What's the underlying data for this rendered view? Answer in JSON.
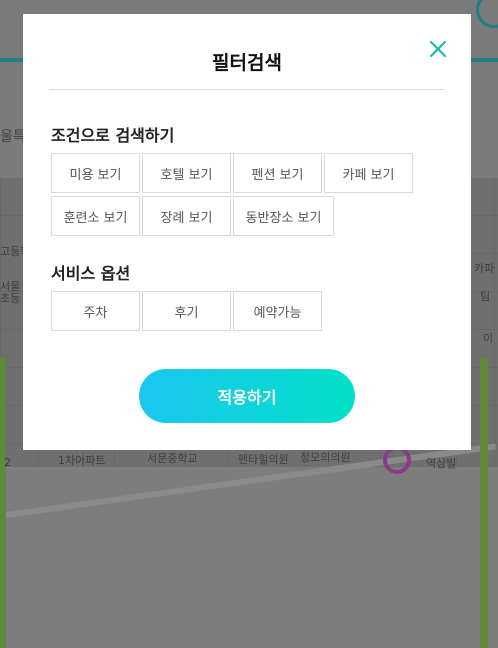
{
  "background": {
    "page_text": "울특",
    "map_labels": [
      "고등학",
      "서울",
      "초등",
      "카파",
      "팀",
      "이",
      "1차아파트",
      "서문중학교",
      "펜타힐의원",
      "정모의의원",
      "역삼빌",
      "2"
    ]
  },
  "modal": {
    "title": "필터검색",
    "condition_section": {
      "title": "조건으로 검색하기",
      "row1": [
        "미용 보기",
        "호텔 보기",
        "펜션 보기",
        "카페 보기"
      ],
      "row2": [
        "훈련소 보기",
        "장례 보기",
        "동반장소 보기"
      ]
    },
    "service_section": {
      "title": "서비스 옵션",
      "options": [
        "주차",
        "후기",
        "예약가능"
      ]
    },
    "apply_label": "적용하기"
  },
  "colors": {
    "accent_teal": "#1fb8b0",
    "apply_gradient_start": "#1cc6f0",
    "apply_gradient_end": "#00e0c8"
  },
  "icons": {
    "close": "close-icon"
  }
}
